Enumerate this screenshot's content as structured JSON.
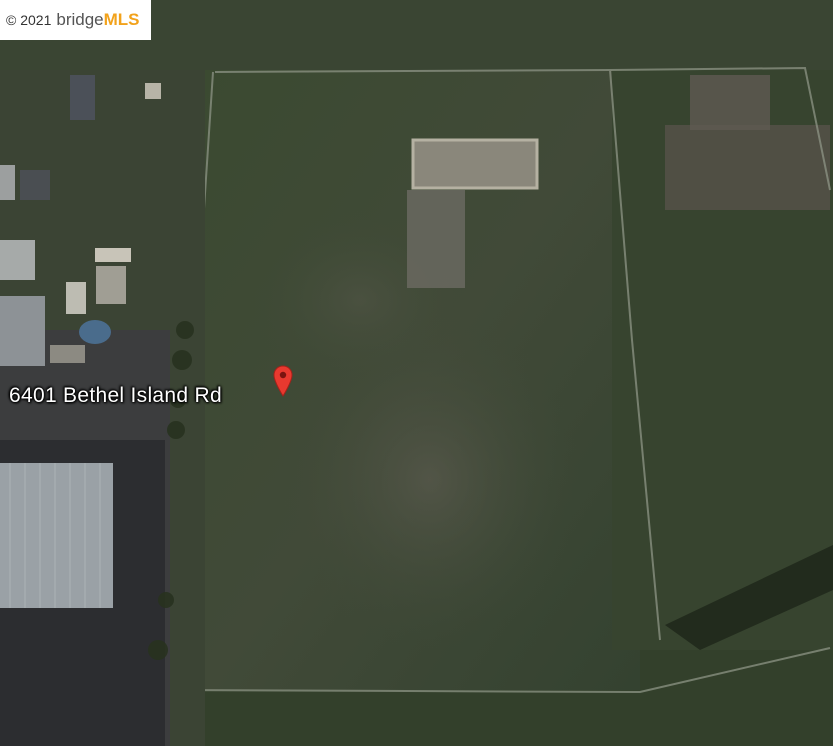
{
  "watermark": {
    "copyright": "© 2021",
    "brand": "bridge",
    "brand_suffix": "MLS",
    "accent_color": "#f2a21b"
  },
  "map": {
    "view": "satellite",
    "marker": {
      "label": "6401 Bethel Island Rd",
      "icon": "map-pin-icon",
      "color": "#e8392f"
    }
  }
}
